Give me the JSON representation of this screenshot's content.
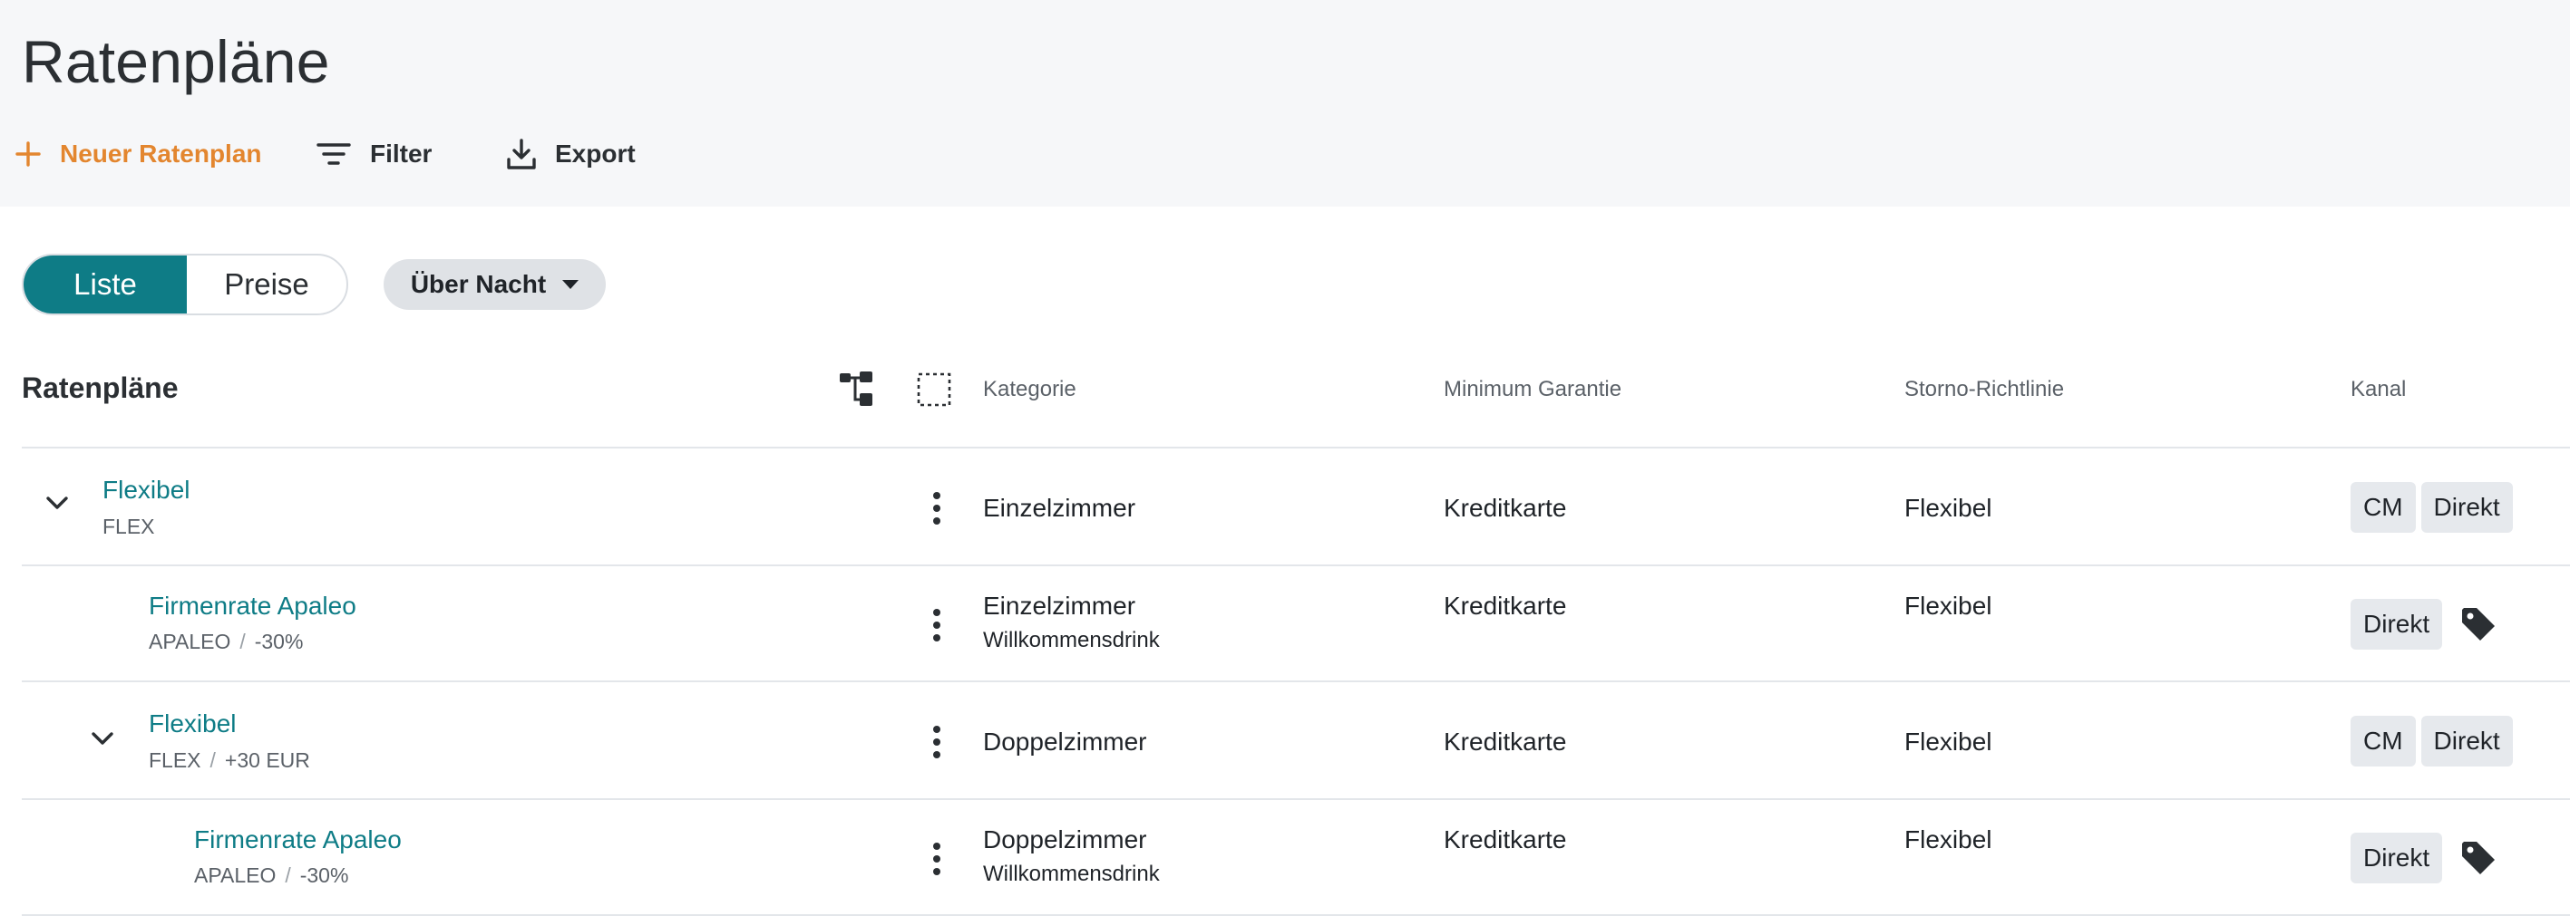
{
  "header": {
    "title": "Ratenpläne",
    "actions": {
      "new": "Neuer Ratenplan",
      "filter": "Filter",
      "export": "Export"
    }
  },
  "view_toggle": {
    "options": [
      "Liste",
      "Preise"
    ],
    "selected": "Liste"
  },
  "period_chip": {
    "label": "Über Nacht"
  },
  "table": {
    "title": "Ratenpläne",
    "columns": {
      "kategorie": "Kategorie",
      "minimum_garantie": "Minimum Garantie",
      "storno": "Storno-Richtlinie",
      "kanal": "Kanal"
    },
    "rows": [
      {
        "name": "Flexibel",
        "code": "FLEX",
        "modifier": "",
        "kategorie": "Einzelzimmer",
        "kategorie_extra": "",
        "garantie": "Kreditkarte",
        "storno": "Flexibel",
        "kanal": [
          "CM",
          "Direkt"
        ],
        "has_tag_icon": false,
        "expandable": true,
        "level": 0
      },
      {
        "name": "Firmenrate Apaleo",
        "code": "APALEO",
        "modifier": "-30%",
        "kategorie": "Einzelzimmer",
        "kategorie_extra": "Willkommensdrink",
        "garantie": "Kreditkarte",
        "storno": "Flexibel",
        "kanal": [
          "Direkt"
        ],
        "has_tag_icon": true,
        "expandable": false,
        "level": 1
      },
      {
        "name": "Flexibel",
        "code": "FLEX",
        "modifier": "+30 EUR",
        "kategorie": "Doppelzimmer",
        "kategorie_extra": "",
        "garantie": "Kreditkarte",
        "storno": "Flexibel",
        "kanal": [
          "CM",
          "Direkt"
        ],
        "has_tag_icon": false,
        "expandable": true,
        "level": 1
      },
      {
        "name": "Firmenrate Apaleo",
        "code": "APALEO",
        "modifier": "-30%",
        "kategorie": "Doppelzimmer",
        "kategorie_extra": "Willkommensdrink",
        "garantie": "Kreditkarte",
        "storno": "Flexibel",
        "kanal": [
          "Direkt"
        ],
        "has_tag_icon": true,
        "expandable": false,
        "level": 2
      }
    ]
  },
  "colors": {
    "accent": "#0e7c86",
    "primary_action": "#e3862f",
    "header_bg": "#f6f7f9",
    "badge_bg": "#e6e9ed"
  },
  "icons": {
    "new": "plus-icon",
    "filter": "filter-lines-icon",
    "export": "download-icon",
    "hierarchy": "hierarchy-icon",
    "select_all": "selection-box-icon",
    "row_menu": "more-vertical-icon",
    "expand": "chevron-down-icon",
    "tag": "price-tag-icon",
    "dropdown": "caret-down-icon"
  }
}
